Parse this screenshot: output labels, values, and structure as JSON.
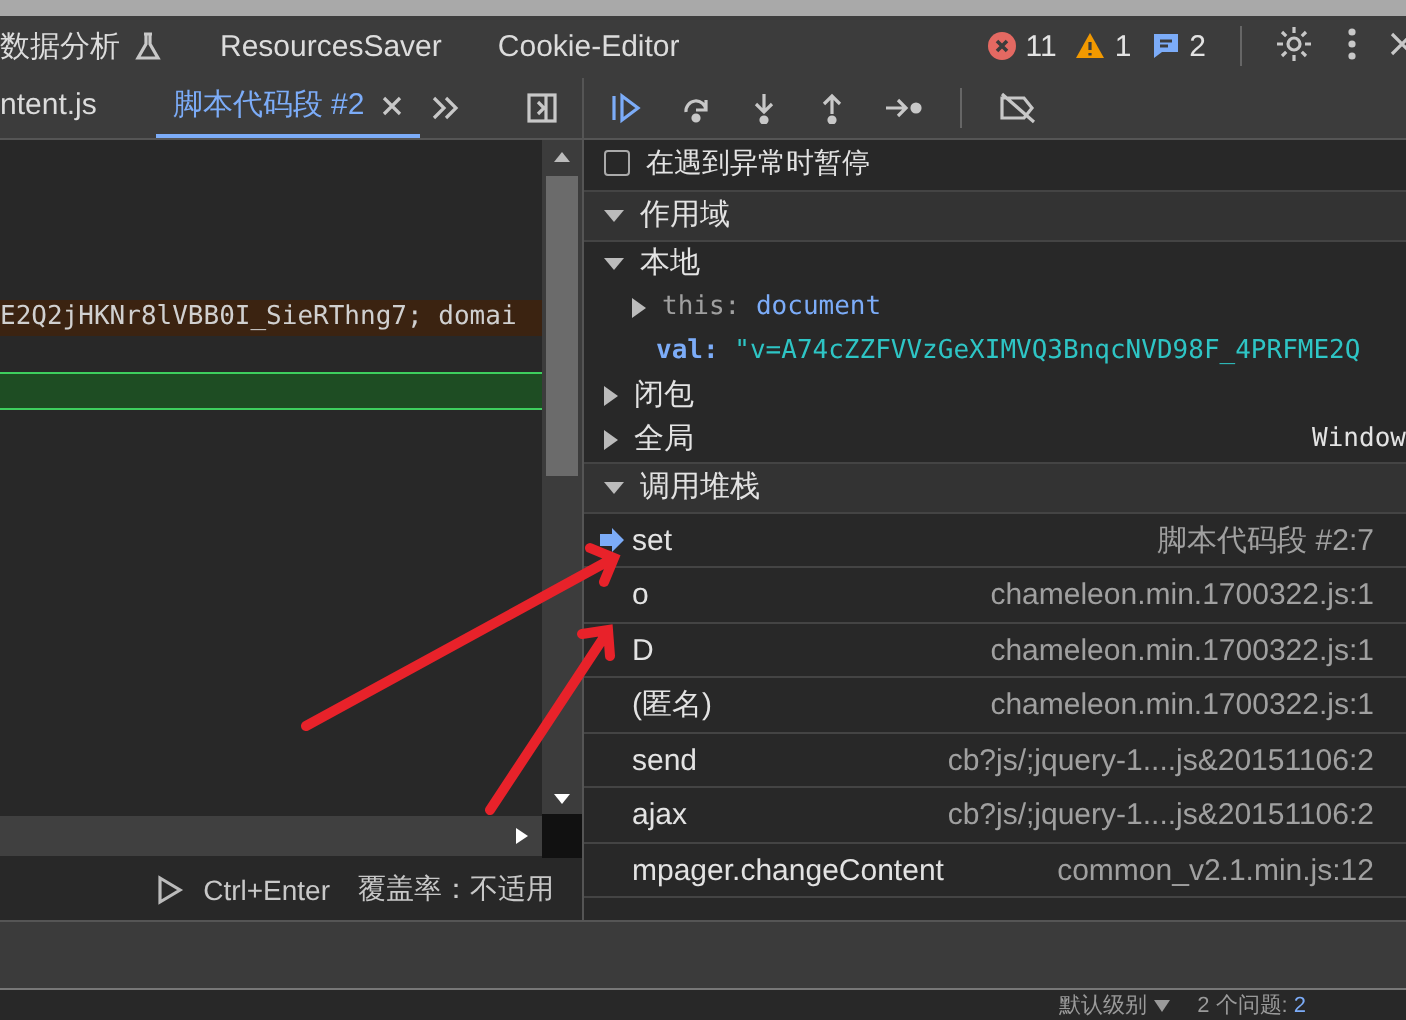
{
  "top_tabs": [
    {
      "label": "数据分析",
      "kind": "experimental"
    },
    {
      "label": "ResourcesSaver",
      "kind": "plain"
    },
    {
      "label": "Cookie-Editor",
      "kind": "plain"
    }
  ],
  "counts": {
    "errors": "11",
    "warnings": "1",
    "messages": "2"
  },
  "file_tabs": [
    {
      "label": "ntent.js",
      "selected": false,
      "closable": false
    },
    {
      "label": "脚本代码段 #2",
      "selected": true,
      "closable": true
    }
  ],
  "editor": {
    "lines": [
      {
        "kind": "plain"
      },
      {
        "kind": "plain"
      },
      {
        "kind": "plain"
      },
      {
        "kind": "plain"
      },
      {
        "kind": "paused",
        "text": "E2Q2jHKNr8lVBB0I_SieRThng7; domai"
      },
      {
        "kind": "plain"
      },
      {
        "kind": "current"
      },
      {
        "kind": "plain"
      },
      {
        "kind": "plain"
      },
      {
        "kind": "plain"
      },
      {
        "kind": "plain"
      },
      {
        "kind": "plain"
      },
      {
        "kind": "plain"
      },
      {
        "kind": "plain"
      },
      {
        "kind": "plain"
      },
      {
        "kind": "plain"
      },
      {
        "kind": "plain"
      },
      {
        "kind": "plain"
      }
    ]
  },
  "run_bar": {
    "shortcut": "Ctrl+Enter",
    "coverage": "覆盖率：不适用"
  },
  "pause_on_exceptions": {
    "label": "在遇到异常时暂停",
    "checked": false
  },
  "scope": {
    "title": "作用域",
    "expanded": true,
    "items": [
      {
        "name": "本地",
        "expanded": true,
        "children": [
          {
            "key": "this:",
            "value": "document",
            "kind": "object"
          },
          {
            "key": "val:",
            "value": "\"v=A74cZZFVVzGeXIMVQ3BnqcNVD98F_4PRFME2Q",
            "kind": "string"
          }
        ]
      },
      {
        "name": "闭包",
        "expanded": false
      },
      {
        "name": "全局",
        "expanded": false,
        "value": "Window"
      }
    ]
  },
  "call_stack": {
    "title": "调用堆栈",
    "expanded": true,
    "frames": [
      {
        "name": "set",
        "location": "脚本代码段 #2:7",
        "selected": true
      },
      {
        "name": "o",
        "location": "chameleon.min.1700322.js:1",
        "selected": false
      },
      {
        "name": "D",
        "location": "chameleon.min.1700322.js:1",
        "selected": false
      },
      {
        "name": "(匿名)",
        "location": "chameleon.min.1700322.js:1",
        "selected": false
      },
      {
        "name": "send",
        "location": "cb?js/;jquery-1....js&20151106:2",
        "selected": false
      },
      {
        "name": "ajax",
        "location": "cb?js/;jquery-1....js&20151106:2",
        "selected": false
      },
      {
        "name": "mpager.changeContent",
        "location": "common_v2.1.min.js:12",
        "selected": false
      }
    ]
  },
  "console_bar": {
    "level": "默认级别",
    "issues": "2 个问题:",
    "issue_count": "2"
  }
}
